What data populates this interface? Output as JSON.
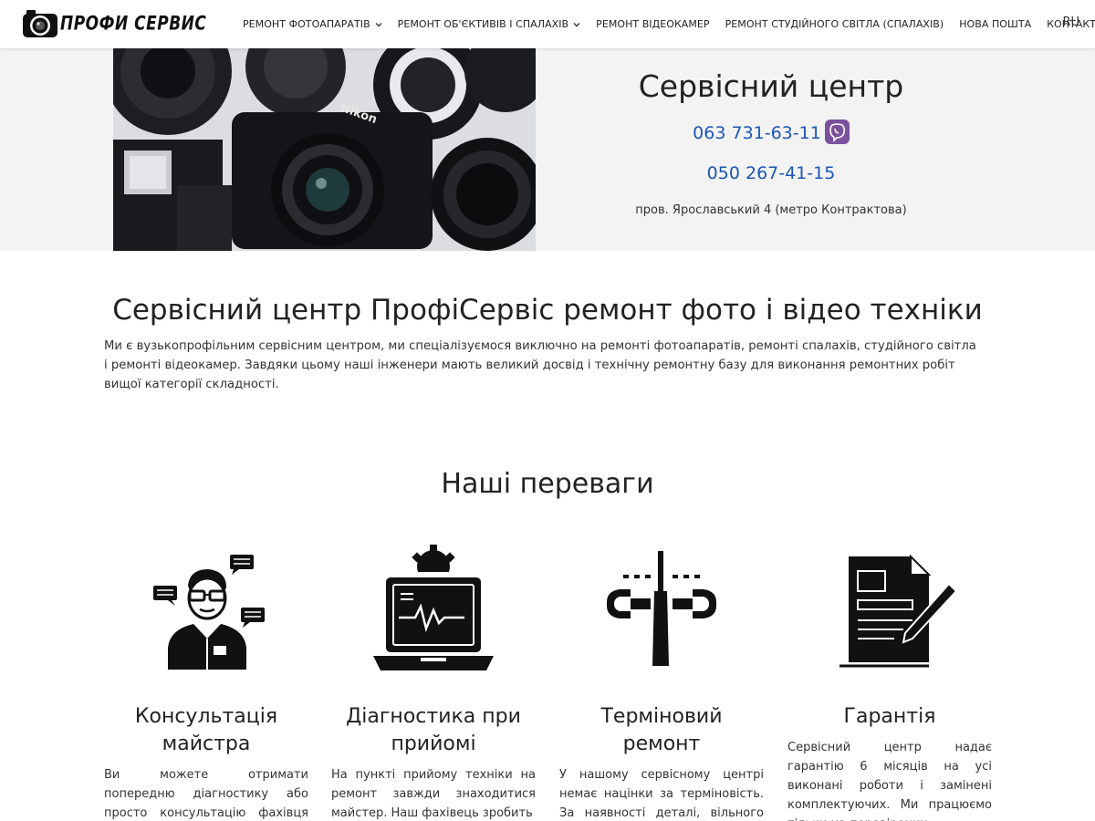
{
  "header": {
    "logo_text": "ПРОФИ СЕРВИС",
    "nav": [
      {
        "label": "РЕМОНТ ФОТОАПАРАТІВ",
        "dropdown": true
      },
      {
        "label": "РЕМОНТ ОБ'ЄКТИВІВ І СПАЛАХІВ",
        "dropdown": true
      },
      {
        "label": "РЕМОНТ ВІДЕОКАМЕР",
        "dropdown": false
      },
      {
        "label": "РЕМОНТ СТУДІЙНОГО СВІТЛА (СПАЛАХІВ)",
        "dropdown": false
      },
      {
        "label": "НОВА ПОШТА",
        "dropdown": false
      },
      {
        "label": "КОНТАКТИ",
        "dropdown": false
      }
    ],
    "lang": "RU"
  },
  "hero": {
    "title": "Сервісний центр",
    "phone1": "063 731-63-11",
    "phone2": "050 267-41-15",
    "address": "пров. Ярославський 4 (метро Контрактова)",
    "phone_color": "#1a57b5",
    "viber_color": "#7b519d"
  },
  "intro": {
    "title": "Сервісний центр ПрофіСервіс ремонт фото і відео техніки",
    "text": "Ми є вузькопрофільним сервісним центром, ми спеціалізуємося виключно на ремонті фотоапаратів, ремонті спалахів, студійного світла і ремонті відеокамер. Завдяки цьому наші інженери мають великий досвід і технічну ремонтну базу для виконання ремонтних робіт вищої категорії складності."
  },
  "advantages": {
    "title": "Наші переваги",
    "items": [
      {
        "icon": "consultant-icon",
        "title": "Консультація майстра",
        "text": "Ви можете отримати попередню діагностику або просто консультацію фахівця по"
      },
      {
        "icon": "diagnostics-laptop-icon",
        "title": "Діагностика при прийомі",
        "text": "На пункті прийому техніки на ремонт завжди знаходитися майстер. Наш фахівець зробить"
      },
      {
        "icon": "tools-icon",
        "title": "Терміновий ремонт",
        "text": "У нашому сервісному центрі немає націнки за терміновість. За наявності деталі, вільного фахівця"
      },
      {
        "icon": "guarantee-document-icon",
        "title": "Гарантія",
        "text": "Сервісний центр надає гарантію 6 місяців на усі виконані роботи і замінені комплектуючих. Ми працюємо тільки на перевірених"
      }
    ]
  }
}
